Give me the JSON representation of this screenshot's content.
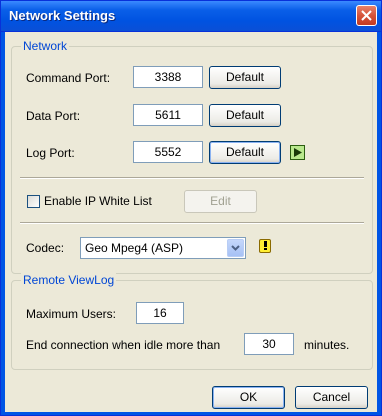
{
  "window": {
    "title": "Network Settings"
  },
  "network": {
    "legend": "Network",
    "command_port": {
      "label": "Command Port:",
      "value": "3388",
      "button": "Default"
    },
    "data_port": {
      "label": "Data Port:",
      "value": "5611",
      "button": "Default"
    },
    "log_port": {
      "label": "Log Port:",
      "value": "5552",
      "button": "Default"
    },
    "ip_whitelist": {
      "label": "Enable IP White List",
      "checked": false,
      "edit_label": "Edit"
    },
    "codec": {
      "label": "Codec:",
      "selected": "Geo Mpeg4 (ASP)"
    }
  },
  "remote_viewlog": {
    "legend": "Remote ViewLog",
    "max_users": {
      "label": "Maximum Users:",
      "value": "16"
    },
    "idle": {
      "label": "End connection when idle more than",
      "value": "30",
      "unit": "minutes."
    }
  },
  "footer": {
    "ok_label": "OK",
    "cancel_label": "Cancel"
  },
  "colors": {
    "title_bar": "#0053e1",
    "client_bg": "#ece9d8",
    "legend_text": "#0046d5"
  },
  "icons": [
    "close-icon",
    "play-icon",
    "warning-icon",
    "chevron-down-icon"
  ]
}
